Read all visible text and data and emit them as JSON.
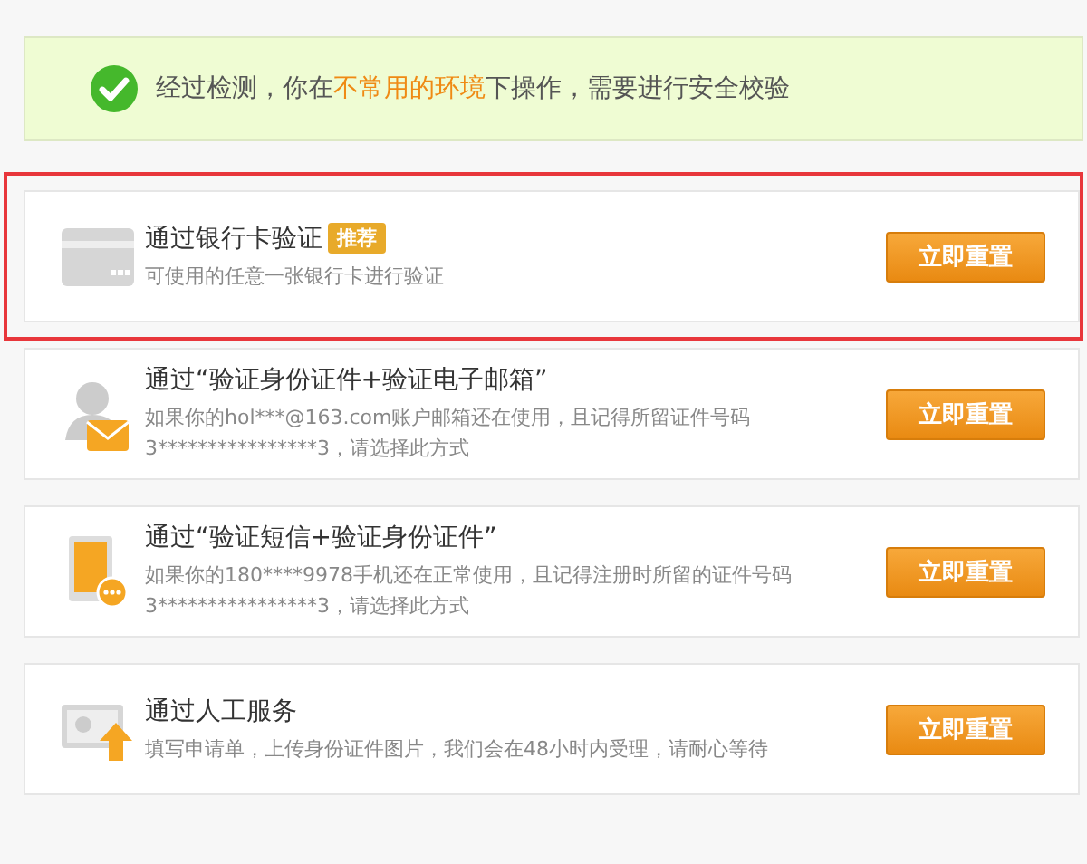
{
  "notice": {
    "parts": [
      {
        "text": "经过检测，你在",
        "emphasis": false
      },
      {
        "text": "不常用的环境",
        "emphasis": true
      },
      {
        "text": "下操作，需要进行安全校验",
        "emphasis": false
      }
    ]
  },
  "options": [
    {
      "kind": "card",
      "title": "通过银行卡验证",
      "badge": "推荐",
      "description": [
        "可使用的任意一张银行卡进行验证"
      ],
      "highlighted": true,
      "button": "立即重置"
    },
    {
      "kind": "person-mail",
      "title": "通过“验证身份证件+验证电子邮箱”",
      "description": [
        "如果你的hol***@163.com账户邮箱还在使用，且记得所留证件号码",
        "3****************3，请选择此方式"
      ],
      "highlighted": false,
      "button": "立即重置"
    },
    {
      "kind": "phone",
      "title": "通过“验证短信+验证身份证件”",
      "description": [
        "如果你的180****9978手机还在正常使用，且记得注册时所留的证件号码",
        "3****************3，请选择此方式"
      ],
      "highlighted": false,
      "button": "立即重置"
    },
    {
      "kind": "upload",
      "title": "通过人工服务",
      "description": [
        "填写申请单，上传身份证件图片，我们会在48小时内受理，请耐心等待"
      ],
      "highlighted": false,
      "button": "立即重置"
    }
  ]
}
